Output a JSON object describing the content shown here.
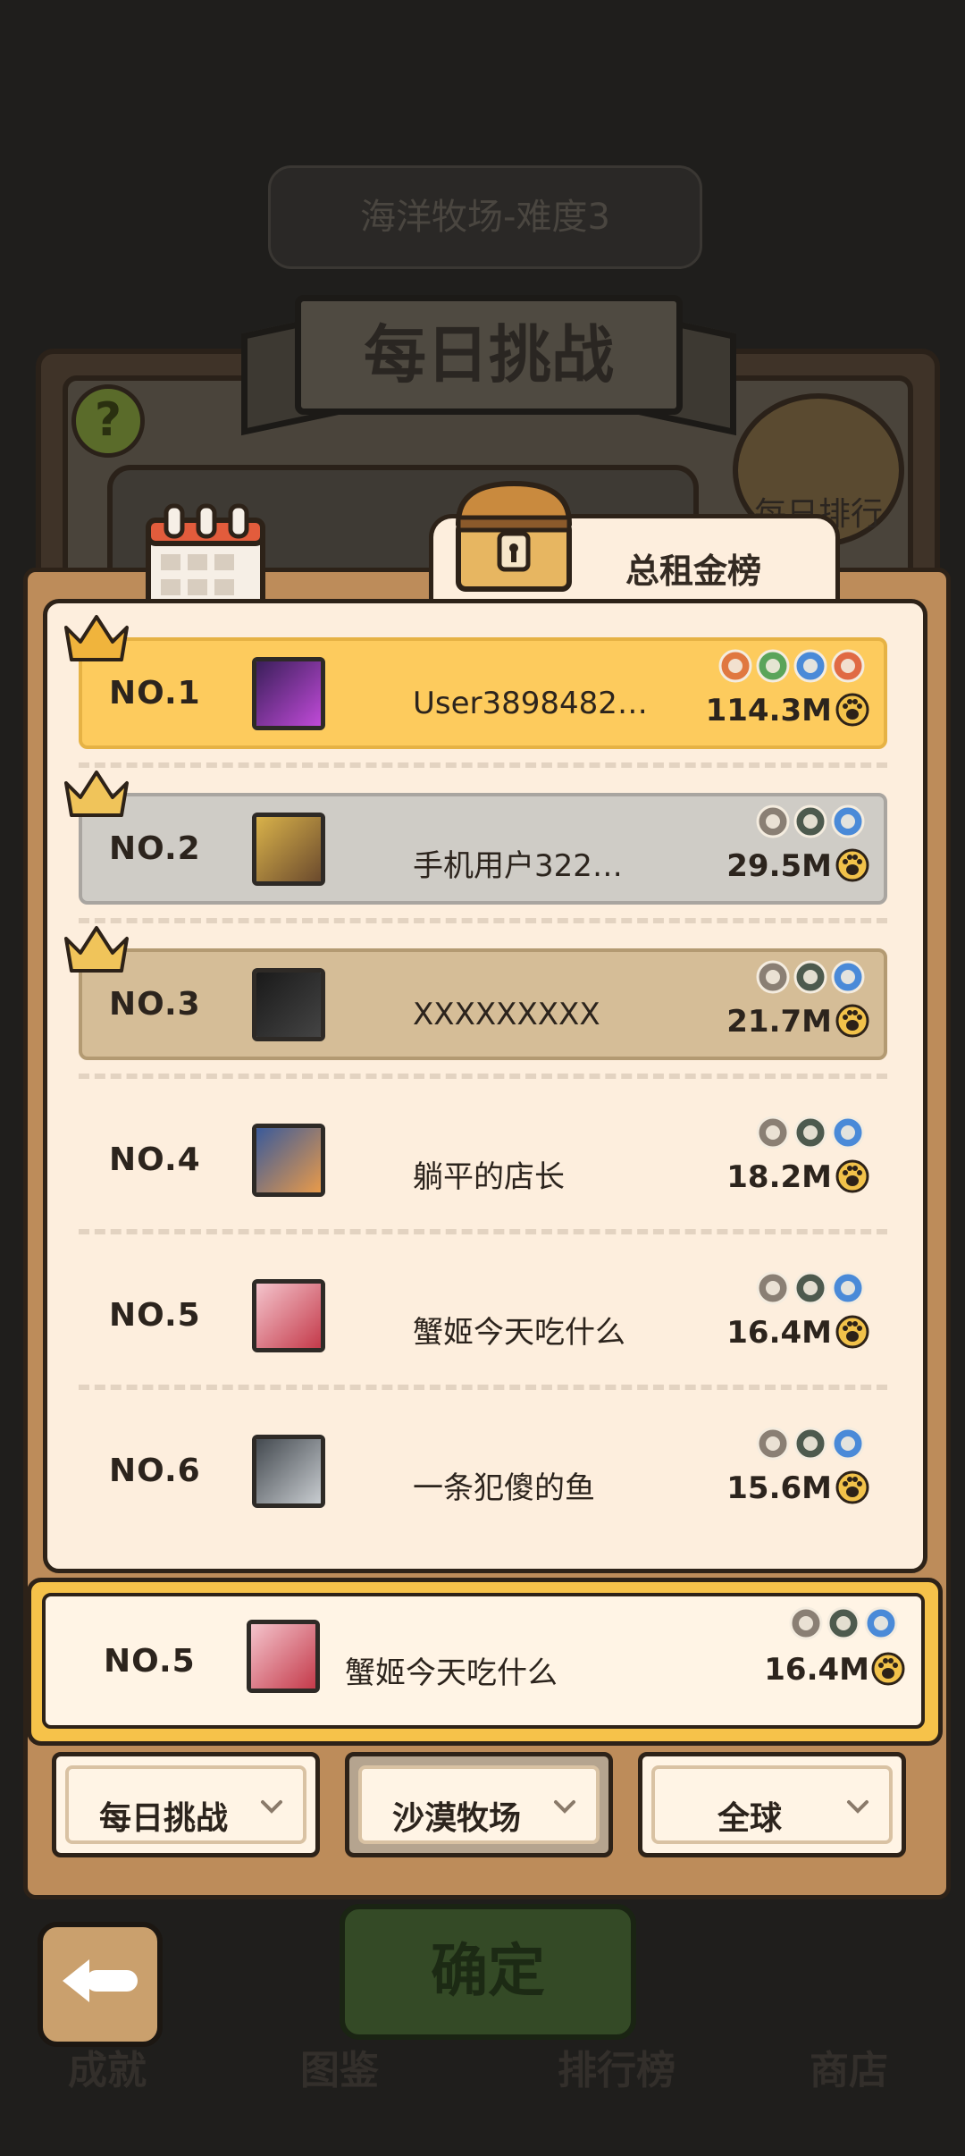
{
  "background": {
    "subtitle": "海洋牧场-难度3",
    "banner_title": "每日挑战",
    "help_icon": "question-icon",
    "daily_rank_label": "每日排行",
    "nav": [
      "成就",
      "图鉴",
      "排行榜",
      "商店"
    ],
    "confirm_label": "确定"
  },
  "back_icon": "back-arrow-icon",
  "tabs": {
    "calendar_icon": "calendar-icon",
    "active_label": "总租金榜",
    "chest_icon": "treasure-chest-icon"
  },
  "leaderboard": [
    {
      "rank": "NO.1",
      "name": "User3898482…",
      "score": "114.3M",
      "tier": "gold",
      "crown": "gold-crown-icon",
      "badges": [
        "#e07840",
        "#5aa45a",
        "#4a8ad8",
        "#e06a44"
      ],
      "avatar_colors": [
        "#3a1f5a",
        "#c04ad8"
      ]
    },
    {
      "rank": "NO.2",
      "name": "手机用户322…",
      "score": "29.5M",
      "tier": "silver",
      "crown": "silver-crown-icon",
      "badges": [
        "#8a7f74",
        "#4d5a4e",
        "#4a8ad8"
      ],
      "avatar_colors": [
        "#d9b24a",
        "#6b4a2d"
      ]
    },
    {
      "rank": "NO.3",
      "name": "XXXXXXXXX",
      "score": "21.7M",
      "tier": "bronze",
      "crown": "bronze-crown-icon",
      "badges": [
        "#8a7f74",
        "#4d5a4e",
        "#4a8ad8"
      ],
      "avatar_colors": [
        "#1a1a1a",
        "#444444"
      ]
    },
    {
      "rank": "NO.4",
      "name": "躺平的店长",
      "score": "18.2M",
      "tier": "plain",
      "crown": "",
      "badges": [
        "#8a7f74",
        "#4d5a4e",
        "#4a8ad8"
      ],
      "avatar_colors": [
        "#3a5a9a",
        "#e89a4a"
      ]
    },
    {
      "rank": "NO.5",
      "name": "蟹姬今天吃什么",
      "score": "16.4M",
      "tier": "plain",
      "crown": "",
      "badges": [
        "#8a7f74",
        "#4d5a4e",
        "#4a8ad8"
      ],
      "avatar_colors": [
        "#f4c4cc",
        "#c43a4a"
      ]
    },
    {
      "rank": "NO.6",
      "name": "一条犯傻的鱼",
      "score": "15.6M",
      "tier": "plain",
      "crown": "",
      "badges": [
        "#8a7f74",
        "#4d5a4e",
        "#4a8ad8"
      ],
      "avatar_colors": [
        "#444a50",
        "#c8ccd0"
      ]
    }
  ],
  "my_entry": {
    "rank": "NO.5",
    "name": "蟹姬今天吃什么",
    "score": "16.4M",
    "badges": [
      "#8a7f74",
      "#4d5a4e",
      "#4a8ad8"
    ],
    "avatar_colors": [
      "#f4c4cc",
      "#c43a4a"
    ]
  },
  "filters": [
    {
      "label": "每日挑战",
      "icon": "chevron-down-icon"
    },
    {
      "label": "沙漠牧场",
      "icon": "chevron-down-icon"
    },
    {
      "label": "全球",
      "icon": "chevron-down-icon"
    }
  ],
  "paw_icon": "paw-coin-icon",
  "colors": {
    "gold": "#fdcb5d",
    "silver": "#cfccc6",
    "bronze": "#d5bd97",
    "panel": "#fdeedd",
    "frame": "#bd8c5a"
  }
}
